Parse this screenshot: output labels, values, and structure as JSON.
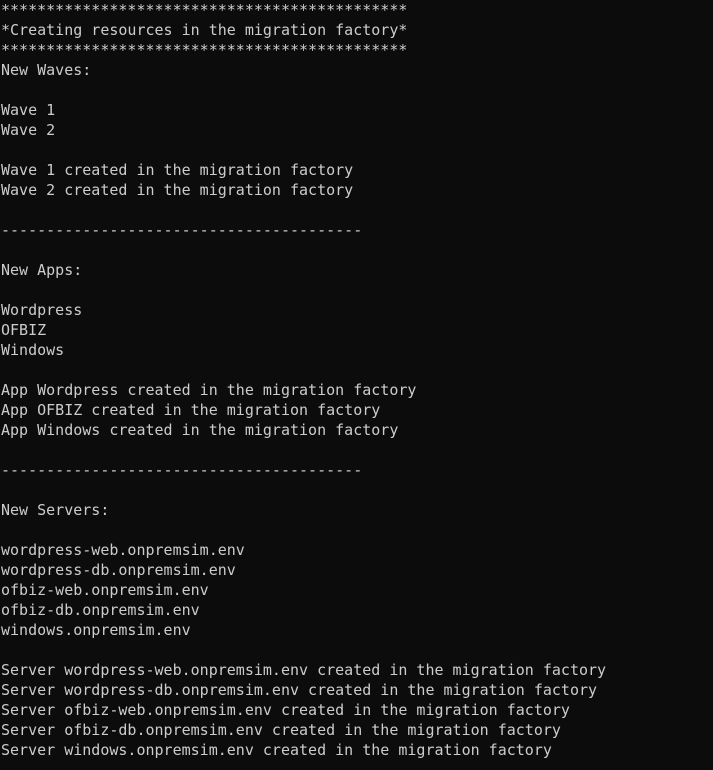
{
  "terminal": {
    "lines": [
      "*********************************************",
      "*Creating resources in the migration factory*",
      "*********************************************",
      "New Waves:",
      "",
      "Wave 1",
      "Wave 2",
      "",
      "Wave 1 created in the migration factory",
      "Wave 2 created in the migration factory",
      "",
      "----------------------------------------",
      "",
      "New Apps:",
      "",
      "Wordpress",
      "OFBIZ",
      "Windows",
      "",
      "App Wordpress created in the migration factory",
      "App OFBIZ created in the migration factory",
      "App Windows created in the migration factory",
      "",
      "----------------------------------------",
      "",
      "New Servers:",
      "",
      "wordpress-web.onpremsim.env",
      "wordpress-db.onpremsim.env",
      "ofbiz-web.onpremsim.env",
      "ofbiz-db.onpremsim.env",
      "windows.onpremsim.env",
      "",
      "Server wordpress-web.onpremsim.env created in the migration factory",
      "Server wordpress-db.onpremsim.env created in the migration factory",
      "Server ofbiz-web.onpremsim.env created in the migration factory",
      "Server ofbiz-db.onpremsim.env created in the migration factory",
      "Server windows.onpremsim.env created in the migration factory"
    ]
  },
  "colors": {
    "background": "#0c0c0c",
    "text": "#cccccc"
  }
}
